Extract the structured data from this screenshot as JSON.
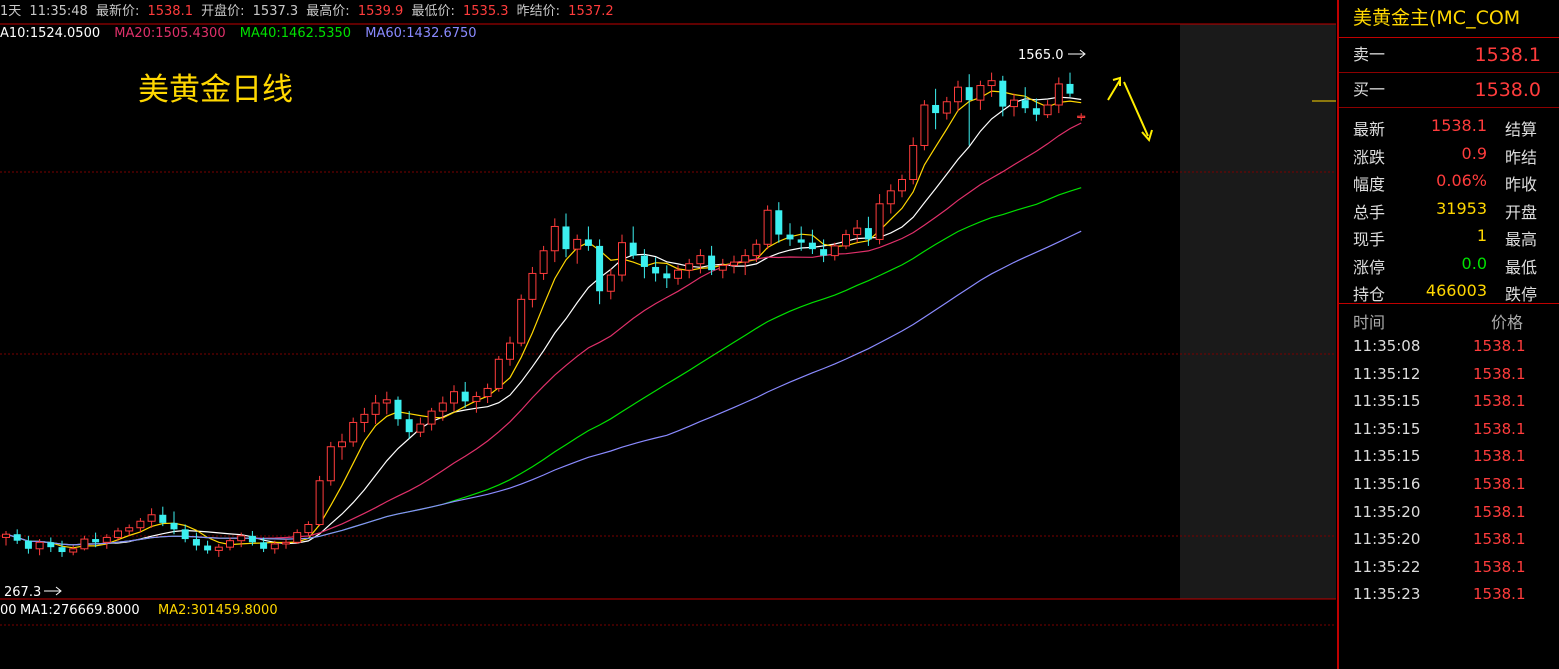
{
  "header": {
    "period": "1天",
    "time": "11:35:48",
    "last_label": "最新价:",
    "last": "1538.1",
    "open_label": "开盘价:",
    "open": "1537.3",
    "high_label": "最高价:",
    "high": "1539.9",
    "low_label": "最低价:",
    "low": "1535.3",
    "settle_label": "昨结价:",
    "settle": "1537.2"
  },
  "ma_legend": [
    {
      "text": "A10:1524.0500",
      "color": "#ffffff"
    },
    {
      "text": "MA20:1505.4300",
      "color": "#e0306a"
    },
    {
      "text": "MA40:1462.5350",
      "color": "#00e000"
    },
    {
      "text": "MA60:1432.6750",
      "color": "#8a8aff"
    }
  ],
  "vol_legend": [
    {
      "text": "00",
      "color": "#ffffff"
    },
    {
      "text": "MA1:276669.8000",
      "color": "#ffffff"
    },
    {
      "text": "MA2:301459.8000",
      "color": "#ffd700"
    }
  ],
  "annotation": "美黄金日线",
  "markers": {
    "high": "1565.0",
    "low": "267.3"
  },
  "panel": {
    "title": "美黄金主(MC_COM",
    "ask_label": "卖一",
    "ask": "1538.1",
    "bid_label": "买一",
    "bid": "1538.0",
    "stats": [
      {
        "label": "最新",
        "value": "1538.1",
        "color": "#ff3c3c",
        "right": "结算"
      },
      {
        "label": "涨跌",
        "value": "0.9",
        "color": "#ff3c3c",
        "right": "昨结"
      },
      {
        "label": "幅度",
        "value": "0.06%",
        "color": "#ff3c3c",
        "right": "昨收"
      },
      {
        "label": "总手",
        "value": "31953",
        "color": "#ffd700",
        "right": "开盘"
      },
      {
        "label": "现手",
        "value": "1",
        "color": "#ffd700",
        "right": "最高"
      },
      {
        "label": "涨停",
        "value": "0.0",
        "color": "#00e000",
        "right": "最低"
      },
      {
        "label": "持仓",
        "value": "466003",
        "color": "#ffd700",
        "right": "跌停"
      }
    ],
    "ticks_header": {
      "time": "时间",
      "price": "价格"
    },
    "ticks": [
      {
        "time": "11:35:08",
        "price": "1538.1"
      },
      {
        "time": "11:35:12",
        "price": "1538.1"
      },
      {
        "time": "11:35:15",
        "price": "1538.1"
      },
      {
        "time": "11:35:15",
        "price": "1538.1"
      },
      {
        "time": "11:35:15",
        "price": "1538.1"
      },
      {
        "time": "11:35:16",
        "price": "1538.1"
      },
      {
        "time": "11:35:20",
        "price": "1538.1"
      },
      {
        "time": "11:35:20",
        "price": "1538.1"
      },
      {
        "time": "11:35:22",
        "price": "1538.1"
      },
      {
        "time": "11:35:23",
        "price": "1538.1"
      }
    ]
  },
  "chart_data": {
    "type": "candlestick",
    "title": "美黄金日线",
    "candles": [
      [
        1278,
        1282,
        1273,
        1280
      ],
      [
        1280,
        1283,
        1274,
        1276
      ],
      [
        1276,
        1279,
        1268,
        1271
      ],
      [
        1271,
        1277,
        1267,
        1275
      ],
      [
        1275,
        1278,
        1269,
        1272
      ],
      [
        1272,
        1276,
        1266,
        1269
      ],
      [
        1269,
        1273,
        1267,
        1271
      ],
      [
        1271,
        1279,
        1270,
        1277
      ],
      [
        1277,
        1281,
        1272,
        1275
      ],
      [
        1275,
        1280,
        1271,
        1278
      ],
      [
        1278,
        1284,
        1276,
        1282
      ],
      [
        1282,
        1286,
        1279,
        1284
      ],
      [
        1284,
        1290,
        1281,
        1288
      ],
      [
        1288,
        1296,
        1284,
        1292
      ],
      [
        1292,
        1297,
        1285,
        1287
      ],
      [
        1287,
        1294,
        1280,
        1283
      ],
      [
        1283,
        1286,
        1275,
        1277
      ],
      [
        1277,
        1281,
        1270,
        1273
      ],
      [
        1273,
        1276,
        1268,
        1270
      ],
      [
        1270,
        1274,
        1266,
        1272
      ],
      [
        1272,
        1278,
        1270,
        1276
      ],
      [
        1276,
        1281,
        1272,
        1279
      ],
      [
        1279,
        1282,
        1273,
        1275
      ],
      [
        1275,
        1278,
        1269,
        1271
      ],
      [
        1271,
        1276,
        1268,
        1274
      ],
      [
        1274,
        1277,
        1271,
        1275
      ],
      [
        1275,
        1283,
        1274,
        1281
      ],
      [
        1281,
        1288,
        1279,
        1286
      ],
      [
        1286,
        1316,
        1285,
        1313
      ],
      [
        1313,
        1337,
        1310,
        1334
      ],
      [
        1334,
        1342,
        1326,
        1337
      ],
      [
        1337,
        1352,
        1334,
        1349
      ],
      [
        1349,
        1358,
        1343,
        1354
      ],
      [
        1354,
        1366,
        1348,
        1361
      ],
      [
        1361,
        1368,
        1354,
        1363
      ],
      [
        1363,
        1365,
        1347,
        1351
      ],
      [
        1351,
        1356,
        1339,
        1343
      ],
      [
        1343,
        1352,
        1340,
        1348
      ],
      [
        1348,
        1358,
        1344,
        1356
      ],
      [
        1356,
        1365,
        1350,
        1361
      ],
      [
        1361,
        1372,
        1356,
        1368
      ],
      [
        1368,
        1374,
        1358,
        1362
      ],
      [
        1362,
        1368,
        1355,
        1365
      ],
      [
        1365,
        1373,
        1361,
        1370
      ],
      [
        1370,
        1390,
        1368,
        1388
      ],
      [
        1388,
        1402,
        1384,
        1398
      ],
      [
        1398,
        1428,
        1396,
        1425
      ],
      [
        1425,
        1445,
        1420,
        1441
      ],
      [
        1441,
        1458,
        1437,
        1455
      ],
      [
        1455,
        1475,
        1448,
        1470
      ],
      [
        1470,
        1478,
        1451,
        1456
      ],
      [
        1456,
        1465,
        1447,
        1462
      ],
      [
        1462,
        1470,
        1455,
        1458
      ],
      [
        1458,
        1462,
        1422,
        1430
      ],
      [
        1430,
        1444,
        1425,
        1440
      ],
      [
        1440,
        1465,
        1436,
        1460
      ],
      [
        1460,
        1470,
        1450,
        1452
      ],
      [
        1452,
        1456,
        1438,
        1445
      ],
      [
        1445,
        1451,
        1436,
        1441
      ],
      [
        1441,
        1446,
        1432,
        1438
      ],
      [
        1438,
        1446,
        1434,
        1443
      ],
      [
        1443,
        1450,
        1438,
        1447
      ],
      [
        1447,
        1456,
        1441,
        1452
      ],
      [
        1452,
        1458,
        1440,
        1443
      ],
      [
        1443,
        1450,
        1438,
        1446
      ],
      [
        1446,
        1452,
        1441,
        1448
      ],
      [
        1448,
        1456,
        1440,
        1452
      ],
      [
        1452,
        1462,
        1448,
        1459
      ],
      [
        1459,
        1483,
        1456,
        1480
      ],
      [
        1480,
        1485,
        1460,
        1465
      ],
      [
        1465,
        1472,
        1458,
        1462
      ],
      [
        1462,
        1470,
        1455,
        1460
      ],
      [
        1460,
        1468,
        1453,
        1456
      ],
      [
        1456,
        1462,
        1448,
        1452
      ],
      [
        1452,
        1460,
        1449,
        1458
      ],
      [
        1458,
        1468,
        1456,
        1465
      ],
      [
        1465,
        1474,
        1460,
        1469
      ],
      [
        1469,
        1476,
        1458,
        1462
      ],
      [
        1462,
        1490,
        1459,
        1484
      ],
      [
        1484,
        1496,
        1478,
        1492
      ],
      [
        1492,
        1502,
        1488,
        1499
      ],
      [
        1499,
        1525,
        1496,
        1520
      ],
      [
        1520,
        1548,
        1517,
        1545
      ],
      [
        1545,
        1555,
        1530,
        1540
      ],
      [
        1540,
        1550,
        1536,
        1547
      ],
      [
        1547,
        1560,
        1541,
        1556
      ],
      [
        1556,
        1564,
        1520,
        1548
      ],
      [
        1548,
        1560,
        1542,
        1557
      ],
      [
        1557,
        1565,
        1550,
        1560
      ],
      [
        1560,
        1563,
        1538,
        1544
      ],
      [
        1544,
        1552,
        1538,
        1548
      ],
      [
        1548,
        1556,
        1540,
        1543
      ],
      [
        1543,
        1549,
        1535,
        1539
      ],
      [
        1539,
        1548,
        1537,
        1545
      ],
      [
        1545,
        1562,
        1540,
        1558
      ],
      [
        1558,
        1565,
        1550,
        1552
      ],
      [
        1537.3,
        1539.9,
        1535.3,
        1538.1
      ]
    ],
    "ma": [
      {
        "name": "MA10",
        "period": 10,
        "color": "#ffffff"
      },
      {
        "name": "MA5",
        "period": 5,
        "color": "#ffd700"
      },
      {
        "name": "MA20",
        "period": 20,
        "color": "#e0306a"
      },
      {
        "name": "MA40",
        "period": 40,
        "color": "#00e000"
      },
      {
        "name": "MA60",
        "period": 60,
        "color": "#8a8aff"
      }
    ],
    "ylim": [
      1240,
      1595
    ],
    "colors": {
      "up": "#ff3c3c",
      "down": "#3cf0f0",
      "grid": "#7a0000"
    }
  }
}
